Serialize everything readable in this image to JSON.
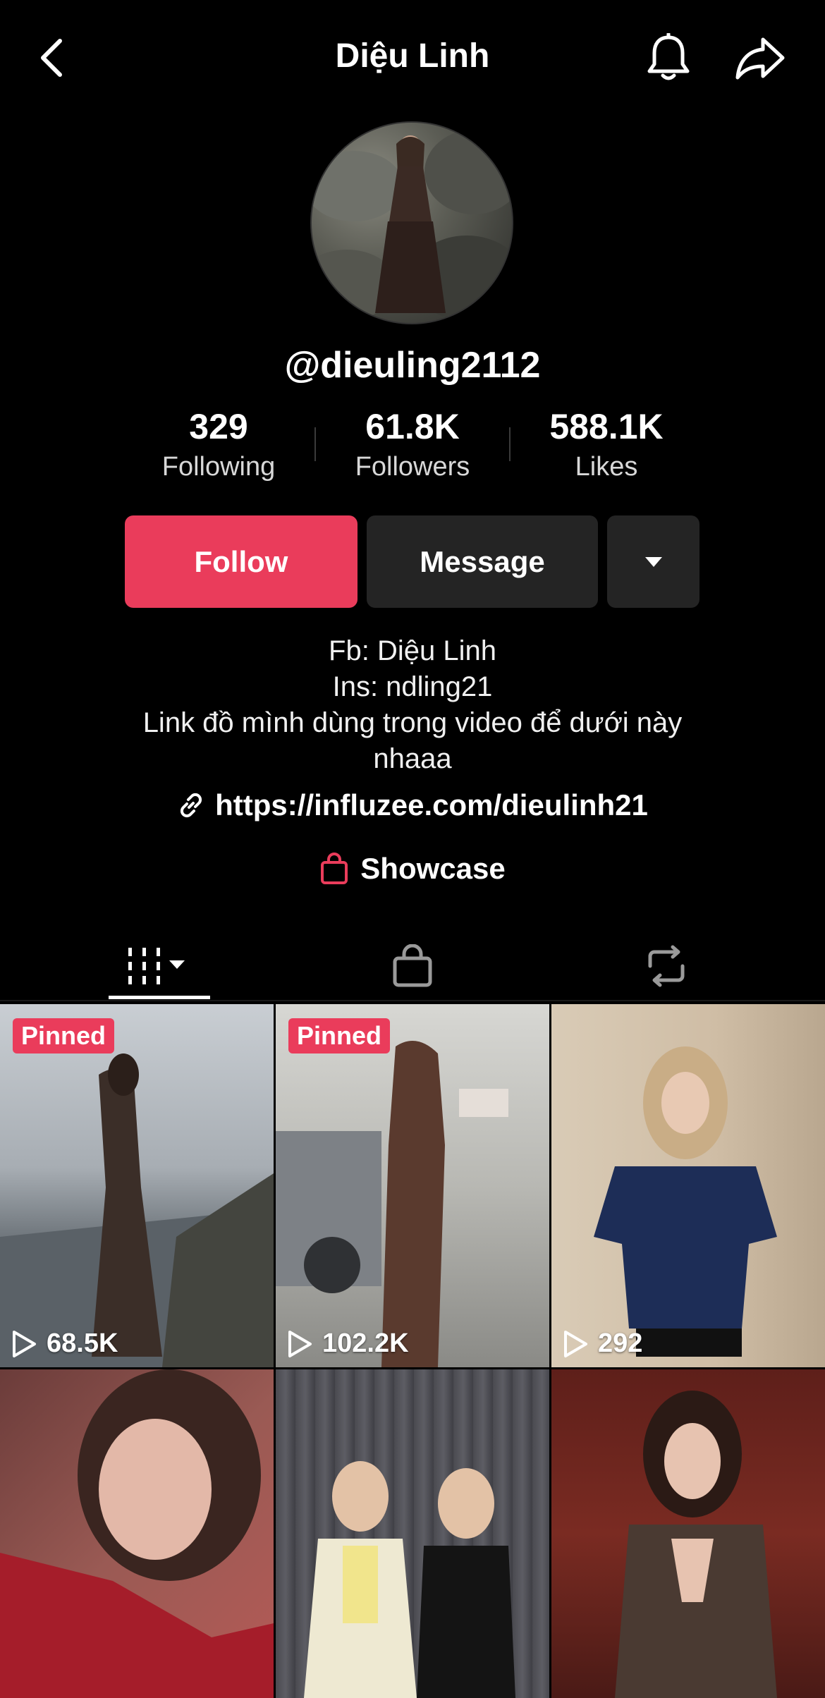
{
  "header": {
    "title": "Diệu Linh",
    "back_icon": "chevron-left-icon",
    "bell_icon": "bell-icon",
    "share_icon": "share-arrow-icon"
  },
  "profile": {
    "handle": "@dieuling2112",
    "stats": [
      {
        "value": "329",
        "label": "Following"
      },
      {
        "value": "61.8K",
        "label": "Followers"
      },
      {
        "value": "588.1K",
        "label": "Likes"
      }
    ]
  },
  "actions": {
    "follow_label": "Follow",
    "message_label": "Message",
    "follow_color": "#EA3C5B",
    "secondary_color": "#242424"
  },
  "bio": {
    "lines": [
      "Fb: Diệu Linh",
      "Ins: ndling21",
      "Link đồ mình dùng trong video để dưới này",
      "nhaaa"
    ],
    "link": "https://influzee.com/dieulinh21",
    "showcase": "Showcase"
  },
  "tabs": [
    "videos-grid-icon",
    "bag-icon",
    "repost-icon"
  ],
  "videos": [
    {
      "pinned": "Pinned",
      "views": "68.5K"
    },
    {
      "pinned": "Pinned",
      "views": "102.2K"
    },
    {
      "pinned": "",
      "views": "292"
    },
    {
      "pinned": "",
      "views": ""
    },
    {
      "pinned": "",
      "views": ""
    },
    {
      "pinned": "",
      "views": ""
    }
  ]
}
